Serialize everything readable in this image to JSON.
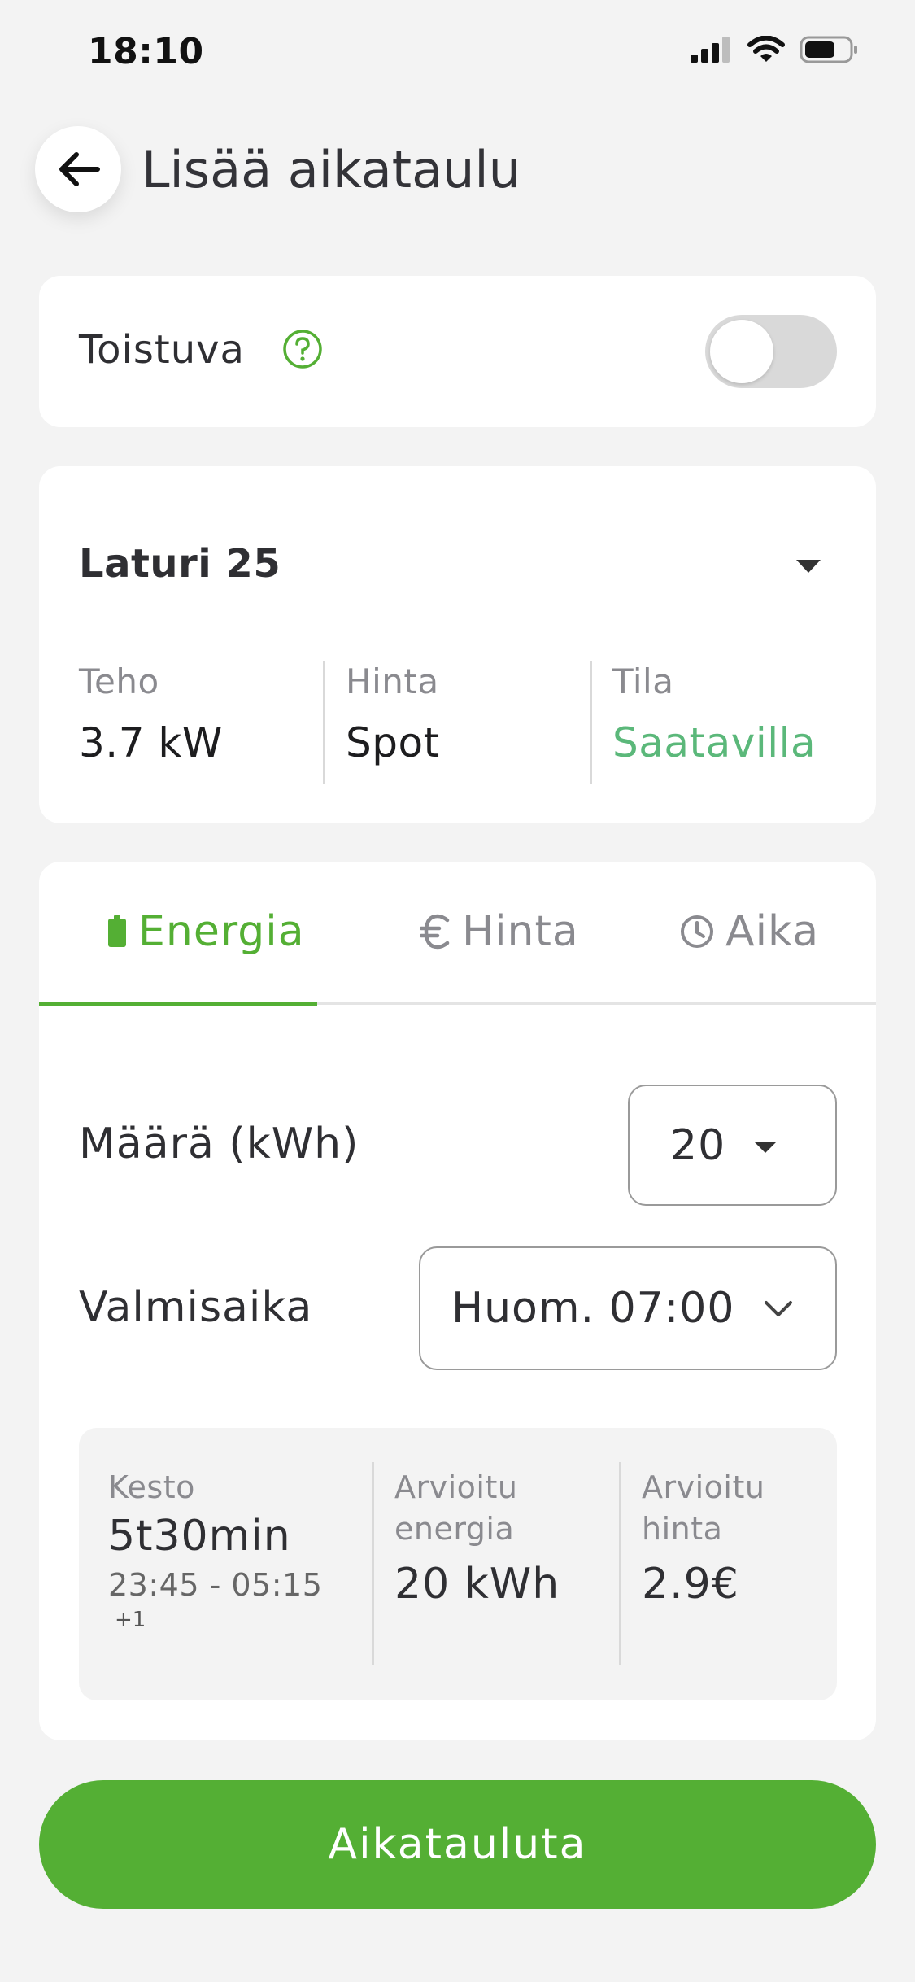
{
  "status_bar": {
    "time": "18:10"
  },
  "header": {
    "title": "Lisää aikataulu"
  },
  "recurring": {
    "label": "Toistuva",
    "enabled": false
  },
  "charger": {
    "name": "Laturi 25",
    "power_label": "Teho",
    "power_value": "3.7 kW",
    "price_label": "Hinta",
    "price_value": "Spot",
    "status_label": "Tila",
    "status_value": "Saatavilla",
    "status_color": "#5bb87a"
  },
  "tabs": [
    {
      "label": "Energia",
      "icon": "battery-icon",
      "active": true
    },
    {
      "label": "Hinta",
      "icon": "euro-icon",
      "active": false
    },
    {
      "label": "Aika",
      "icon": "clock-icon",
      "active": false
    }
  ],
  "form": {
    "amount_label": "Määrä (kWh)",
    "amount_value": "20",
    "ready_label": "Valmisaika",
    "ready_value": "Huom. 07:00"
  },
  "summary": {
    "duration_label": "Kesto",
    "duration_value": "5t30min",
    "duration_range": "23:45 - 05:15",
    "duration_day_offset": "+1",
    "energy_label_line1": "Arvioitu",
    "energy_label_line2": "energia",
    "energy_value": "20 kWh",
    "price_label_line1": "Arvioitu",
    "price_label_line2": "hinta",
    "price_value": "2.9€"
  },
  "cta": {
    "label": "Aikatauluta"
  },
  "colors": {
    "accent": "#54af34",
    "background": "#f3f3f3"
  }
}
